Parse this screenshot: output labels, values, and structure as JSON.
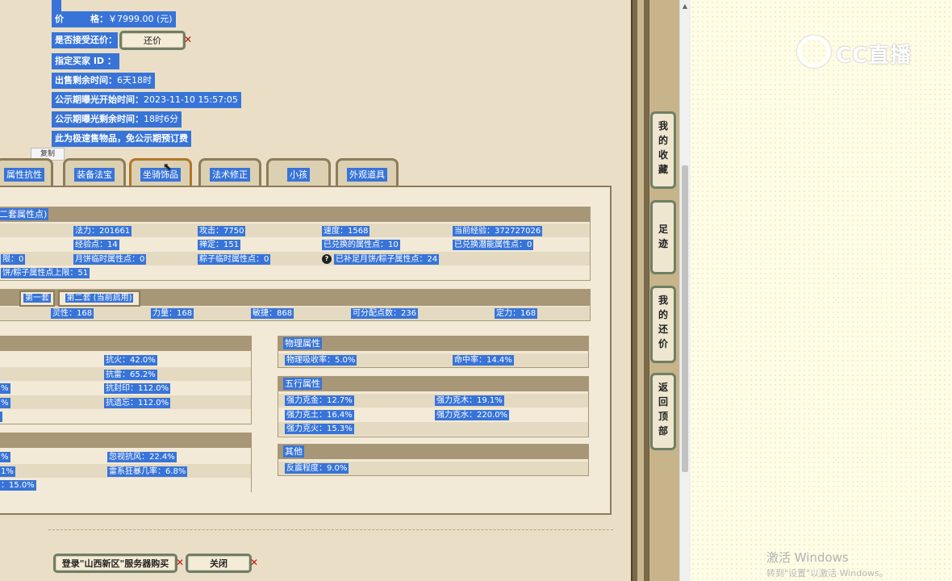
{
  "info": {
    "price_label": "价　　　格：",
    "price_value": "￥7999.00 (元)",
    "counter_offer_label": "是否接受还价：",
    "counter_offer_button": "还价",
    "seller_id_label": "指定买家 ID ：",
    "remaining_time_label": "出售剩余时间：",
    "remaining_time_value": "6天18时",
    "public_start_label": "公示期曝光开始时间：",
    "public_start_value": "2023-11-10 15:57:05",
    "public_remaining_label": "公示期曝光剩余时间：",
    "public_remaining_value": "18时6分",
    "fast_sale_note": "此为极速售物品，免公示期预订费",
    "copy_tooltip": "复制"
  },
  "tabs": [
    "属性抗性",
    "装备法宝",
    "坐骑饰品",
    "法术修正",
    "小孩",
    "外观道具"
  ],
  "attr_box": {
    "header": "二套属性点)",
    "rows": [
      [
        "法力：201661",
        "攻击：7750",
        "速度：1568",
        "当前经验：372727026"
      ],
      [
        "经验点：14",
        "禅定：151",
        "已兑换的属性点：10",
        "已兑换潜能属性点：0"
      ],
      [
        "限：0",
        "月饼临时属性点：0",
        "粽子临时属性点：0",
        "已补足月饼/粽子属性点：24"
      ],
      [
        "饼/粽子属性点上限：51"
      ]
    ]
  },
  "set_tabs": {
    "first": "第一套",
    "second": "第二套 (当前启用)",
    "stats": [
      "灵性：168",
      "力量：168",
      "敏捷：868",
      "可分配点数：236",
      "定力：168"
    ]
  },
  "resist_box": {
    "values": [
      "抗火：42.0%",
      "抗雷：65.2%",
      "抗封印：112.0%",
      "抗遗忘：112.0%"
    ],
    "left_fragments": [
      "%",
      "%",
      ""
    ]
  },
  "ignore_box": {
    "values": [
      "忽视抗风：22.4%",
      "雷系狂暴几率：6.8%"
    ],
    "left_fragments": [
      "%",
      "1%",
      "：15.0%"
    ]
  },
  "physical_box": {
    "header": "物理属性",
    "values": [
      "物理吸收率：5.0%",
      "命中率：14.4%"
    ]
  },
  "element_box": {
    "header": "五行属性",
    "values": [
      "强力克金：12.7%",
      "强力克木：19.1%",
      "强力克土：16.4%",
      "强力克水：220.0%",
      "强力克火：15.3%"
    ]
  },
  "other_box": {
    "header": "其他",
    "values": [
      "反震程度：9.0%"
    ]
  },
  "bottom_buttons": {
    "login": "登录\"山西新区\"服务器购买",
    "close": "关闭"
  },
  "side_buttons": [
    "我的收藏",
    "足迹",
    "我的还价",
    "返回顶部"
  ],
  "watermark": {
    "logo_text": "CC直播",
    "windows_line1": "激活 Windows",
    "windows_line2": "转到\"设置\"以激活 Windows。"
  }
}
